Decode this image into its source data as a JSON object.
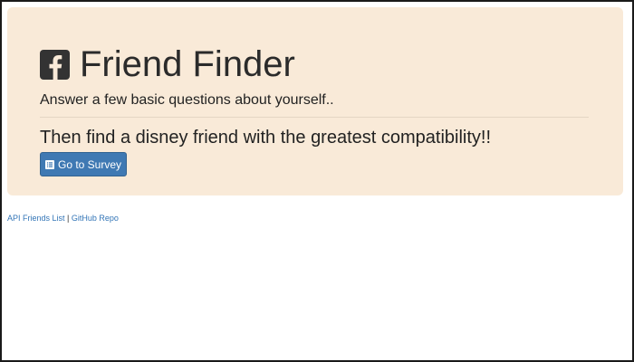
{
  "header": {
    "title": "Friend Finder",
    "icon": "facebook-square-icon"
  },
  "content": {
    "subtitle": "Answer a few basic questions about yourself..",
    "headline": "Then find a disney friend with the greatest compatibility!!",
    "button_label": "Go to Survey",
    "button_icon": "list-alt-icon"
  },
  "footer": {
    "api_link_label": "API Friends List",
    "separator": "|",
    "github_link_label": "GitHub Repo"
  },
  "colors": {
    "jumbotron_background": "#f9ead8",
    "button_background": "#3f79b3",
    "link_color": "#3375b7"
  }
}
